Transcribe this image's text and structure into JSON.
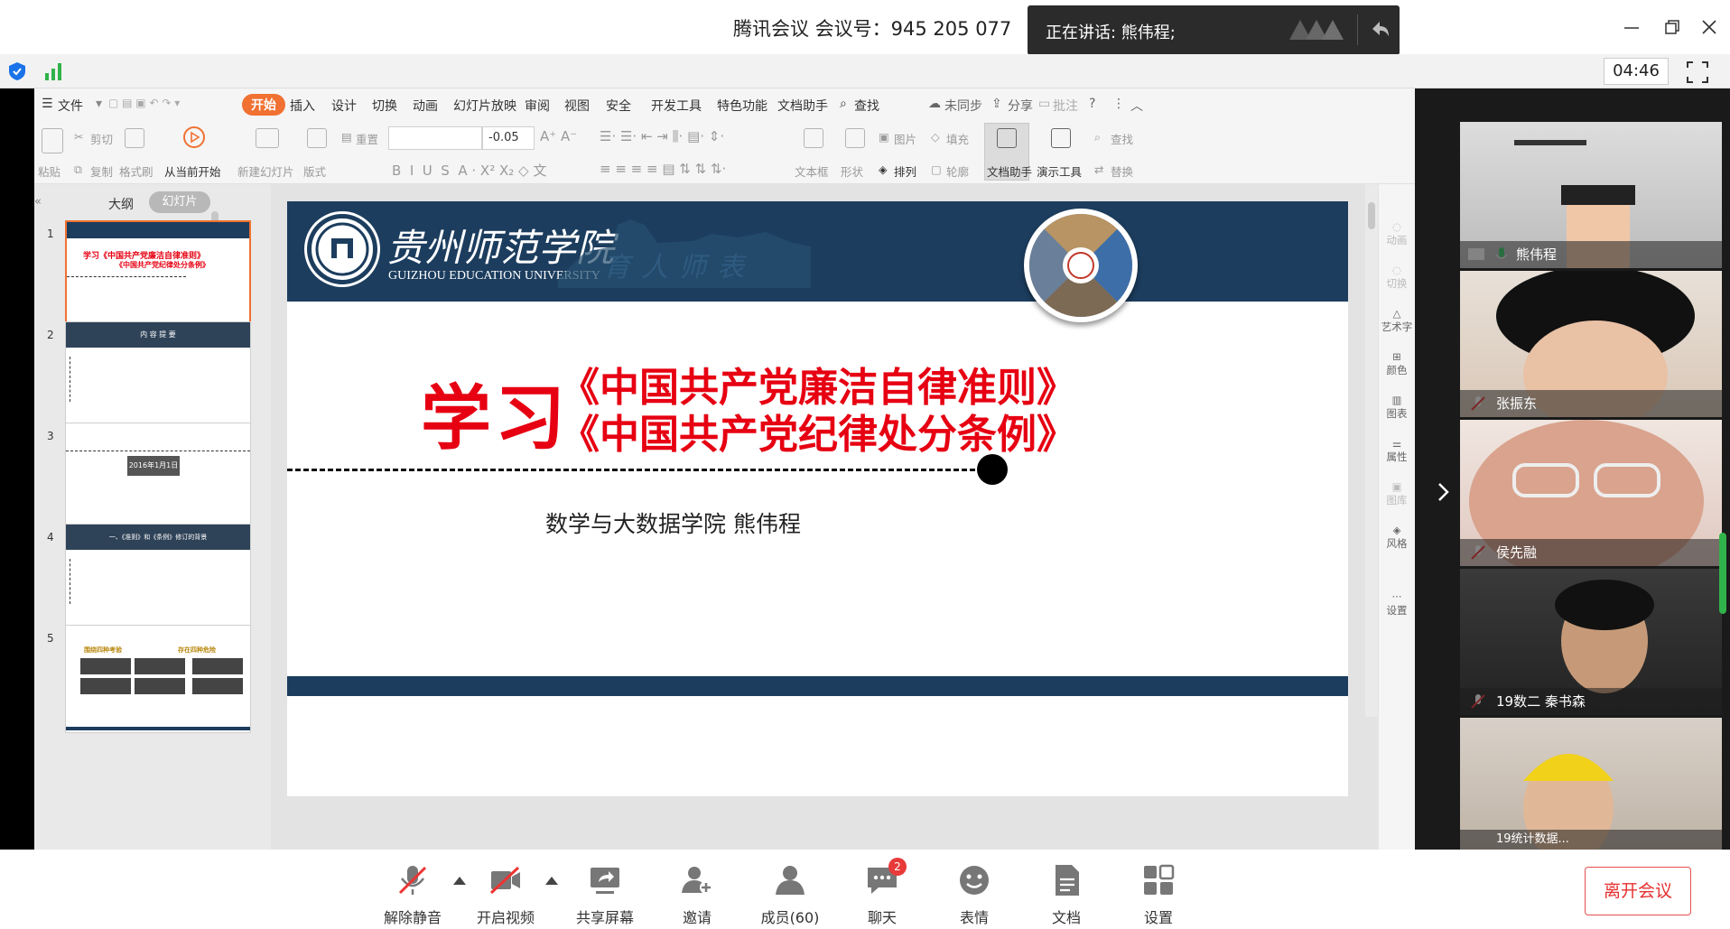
{
  "meeting": {
    "title": "腾讯会议 会议号：945 205 077",
    "speaking": "正在讲话: 熊伟程;",
    "timer": "04:46"
  },
  "wps": {
    "file_menu": "文件",
    "menus": [
      "开始",
      "插入",
      "设计",
      "切换",
      "动画",
      "幻灯片放映",
      "审阅",
      "视图",
      "安全",
      "开发工具",
      "特色功能",
      "文档助手"
    ],
    "search": "查找",
    "sync": "未同步",
    "share": "分享",
    "annotate": "批注",
    "ribbon": {
      "paste": "粘贴",
      "cut": "剪切",
      "copy": "复制",
      "format_painter": "格式刷",
      "play_from_current": "从当前开始",
      "new_slide": "新建幻灯片",
      "layout": "版式",
      "reset": "重置",
      "font_size": "-0.05",
      "textbox": "文本框",
      "shape": "形状",
      "arrange": "排列",
      "picture": "图片",
      "fill": "填充",
      "outline": "轮廓",
      "doc_assistant": "文档助手",
      "present_tools": "演示工具",
      "find": "查找",
      "replace": "替换"
    },
    "pane_tabs": {
      "outline": "大纲",
      "slides": "幻灯片"
    },
    "thumbnails": [
      {
        "num": "1",
        "line1": "学习《中国共产党廉洁自律准则》",
        "line2": "《中国共产党纪律处分条例》"
      },
      {
        "num": "2",
        "title": "内 容 提 要"
      },
      {
        "num": "3",
        "date": "2016年1月1日"
      },
      {
        "num": "4",
        "title": "一、《准则》和《条例》修订的背景"
      },
      {
        "num": "5",
        "left": "围绕四种考验",
        "right": "存在四种危险"
      }
    ],
    "slide": {
      "university_cn": "贵州师范学院",
      "university_en": "GUIZHOU EDUCATION UNIVERSITY",
      "motto": "育人师表",
      "big_word": "学习",
      "title_line1": "《中国共产党廉洁自律准则》",
      "title_line2": "《中国共产党纪律处分条例》",
      "author": "数学与大数据学院  熊伟程"
    },
    "right_panel": [
      "动画",
      "切换",
      "艺术字",
      "颜色",
      "图表",
      "属性",
      "图库",
      "风格",
      "设置"
    ]
  },
  "participants": [
    {
      "name": "熊伟程"
    },
    {
      "name": "张振东"
    },
    {
      "name": "侯先融"
    },
    {
      "name": "19数二 秦书森"
    },
    {
      "name": "19统计数据..."
    }
  ],
  "toolbar": {
    "items": [
      "解除静音",
      "开启视频",
      "共享屏幕",
      "邀请",
      "成员(60)",
      "聊天",
      "表情",
      "文档",
      "设置"
    ],
    "chat_badge": "2",
    "leave": "离开会议"
  },
  "colors": {
    "accent": "#f07131",
    "slide_banner": "#1c3d5e",
    "title_red": "#e60012",
    "leave_red": "#e53030"
  }
}
